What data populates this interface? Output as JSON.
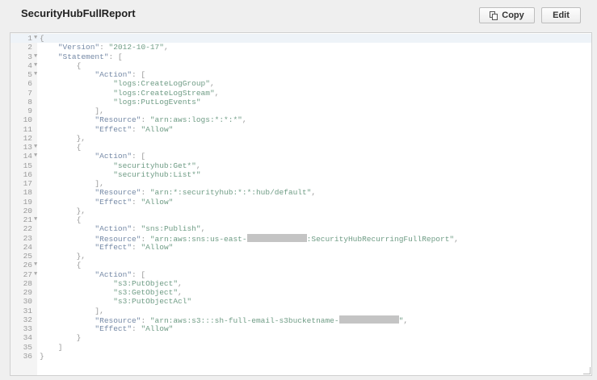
{
  "header": {
    "title": "SecurityHubFullReport",
    "copy_label": "Copy",
    "edit_label": "Edit"
  },
  "editor": {
    "folds": [
      1,
      3,
      4,
      5,
      13,
      14,
      21,
      26,
      27
    ],
    "lines": [
      [
        [
          "p",
          "{"
        ]
      ],
      [
        [
          "p",
          "    "
        ],
        [
          "k",
          "\"Version\""
        ],
        [
          "p",
          ": "
        ],
        [
          "s",
          "\"2012-10-17\""
        ],
        [
          "p",
          ","
        ]
      ],
      [
        [
          "p",
          "    "
        ],
        [
          "k",
          "\"Statement\""
        ],
        [
          "p",
          ": ["
        ]
      ],
      [
        [
          "p",
          "        {"
        ]
      ],
      [
        [
          "p",
          "            "
        ],
        [
          "k",
          "\"Action\""
        ],
        [
          "p",
          ": ["
        ]
      ],
      [
        [
          "p",
          "                "
        ],
        [
          "s",
          "\"logs:CreateLogGroup\""
        ],
        [
          "p",
          ","
        ]
      ],
      [
        [
          "p",
          "                "
        ],
        [
          "s",
          "\"logs:CreateLogStream\""
        ],
        [
          "p",
          ","
        ]
      ],
      [
        [
          "p",
          "                "
        ],
        [
          "s",
          "\"logs:PutLogEvents\""
        ]
      ],
      [
        [
          "p",
          "            ],"
        ]
      ],
      [
        [
          "p",
          "            "
        ],
        [
          "k",
          "\"Resource\""
        ],
        [
          "p",
          ": "
        ],
        [
          "s",
          "\"arn:aws:logs:*:*:*\""
        ],
        [
          "p",
          ","
        ]
      ],
      [
        [
          "p",
          "            "
        ],
        [
          "k",
          "\"Effect\""
        ],
        [
          "p",
          ": "
        ],
        [
          "s",
          "\"Allow\""
        ]
      ],
      [
        [
          "p",
          "        },"
        ]
      ],
      [
        [
          "p",
          "        {"
        ]
      ],
      [
        [
          "p",
          "            "
        ],
        [
          "k",
          "\"Action\""
        ],
        [
          "p",
          ": ["
        ]
      ],
      [
        [
          "p",
          "                "
        ],
        [
          "s",
          "\"securityhub:Get*\""
        ],
        [
          "p",
          ","
        ]
      ],
      [
        [
          "p",
          "                "
        ],
        [
          "s",
          "\"securityhub:List*\""
        ]
      ],
      [
        [
          "p",
          "            ],"
        ]
      ],
      [
        [
          "p",
          "            "
        ],
        [
          "k",
          "\"Resource\""
        ],
        [
          "p",
          ": "
        ],
        [
          "s",
          "\"arn:*:securityhub:*:*:hub/default\""
        ],
        [
          "p",
          ","
        ]
      ],
      [
        [
          "p",
          "            "
        ],
        [
          "k",
          "\"Effect\""
        ],
        [
          "p",
          ": "
        ],
        [
          "s",
          "\"Allow\""
        ]
      ],
      [
        [
          "p",
          "        },"
        ]
      ],
      [
        [
          "p",
          "        {"
        ]
      ],
      [
        [
          "p",
          "            "
        ],
        [
          "k",
          "\"Action\""
        ],
        [
          "p",
          ": "
        ],
        [
          "s",
          "\"sns:Publish\""
        ],
        [
          "p",
          ","
        ]
      ],
      [
        [
          "p",
          "            "
        ],
        [
          "k",
          "\"Resource\""
        ],
        [
          "p",
          ": "
        ],
        [
          "s",
          "\"arn:aws:sns:us-east-"
        ],
        [
          "r",
          "13"
        ],
        [
          "s",
          ":SecurityHubRecurringFullReport\""
        ],
        [
          "p",
          ","
        ]
      ],
      [
        [
          "p",
          "            "
        ],
        [
          "k",
          "\"Effect\""
        ],
        [
          "p",
          ": "
        ],
        [
          "s",
          "\"Allow\""
        ]
      ],
      [
        [
          "p",
          "        },"
        ]
      ],
      [
        [
          "p",
          "        {"
        ]
      ],
      [
        [
          "p",
          "            "
        ],
        [
          "k",
          "\"Action\""
        ],
        [
          "p",
          ": ["
        ]
      ],
      [
        [
          "p",
          "                "
        ],
        [
          "s",
          "\"s3:PutObject\""
        ],
        [
          "p",
          ","
        ]
      ],
      [
        [
          "p",
          "                "
        ],
        [
          "s",
          "\"s3:GetObject\""
        ],
        [
          "p",
          ","
        ]
      ],
      [
        [
          "p",
          "                "
        ],
        [
          "s",
          "\"s3:PutObjectAcl\""
        ]
      ],
      [
        [
          "p",
          "            ],"
        ]
      ],
      [
        [
          "p",
          "            "
        ],
        [
          "k",
          "\"Resource\""
        ],
        [
          "p",
          ": "
        ],
        [
          "s",
          "\"arn:aws:s3:::sh-full-email-s3bucketname-"
        ],
        [
          "r",
          "13"
        ],
        [
          "s",
          "\""
        ],
        [
          "p",
          ","
        ]
      ],
      [
        [
          "p",
          "            "
        ],
        [
          "k",
          "\"Effect\""
        ],
        [
          "p",
          ": "
        ],
        [
          "s",
          "\"Allow\""
        ]
      ],
      [
        [
          "p",
          "        }"
        ]
      ],
      [
        [
          "p",
          "    ]"
        ]
      ],
      [
        [
          "p",
          "}"
        ]
      ]
    ]
  }
}
